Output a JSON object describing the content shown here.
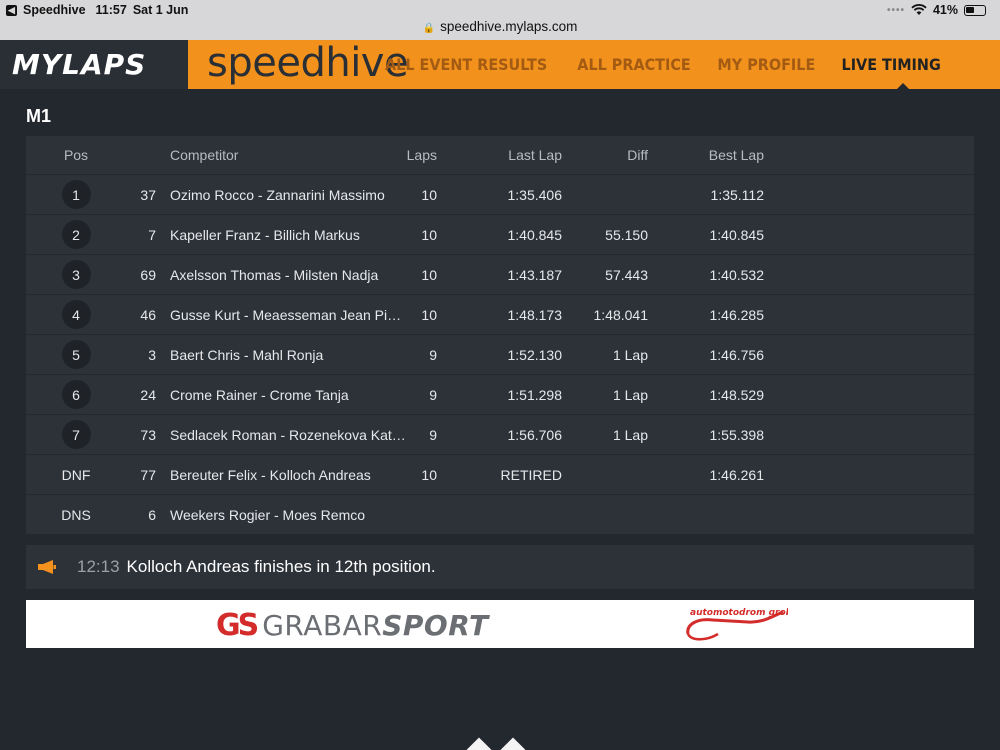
{
  "status_bar": {
    "app": "Speedhive",
    "time": "11:57",
    "date": "Sat 1 Jun",
    "battery": "41%",
    "url": "speedhive.mylaps.com"
  },
  "header": {
    "logo": "MYLAPS",
    "brand": "speedhive",
    "nav": [
      "ALL EVENT RESULTS",
      "ALL PRACTICE",
      "MY PROFILE",
      "LIVE TIMING"
    ],
    "active_nav": "LIVE TIMING",
    "accent_color": "#f2921c"
  },
  "session": {
    "class_name": "M1"
  },
  "table": {
    "headers": {
      "pos": "Pos",
      "competitor": "Competitor",
      "laps": "Laps",
      "last_lap": "Last Lap",
      "diff": "Diff",
      "best_lap": "Best Lap"
    },
    "rows": [
      {
        "pos": "1",
        "num": "37",
        "name": "Ozimo Rocco - Zannarini Massimo",
        "laps": "10",
        "last": "1:35.406",
        "diff": "",
        "best": "1:35.112"
      },
      {
        "pos": "2",
        "num": "7",
        "name": "Kapeller Franz - Billich Markus",
        "laps": "10",
        "last": "1:40.845",
        "diff": "55.150",
        "best": "1:40.845"
      },
      {
        "pos": "3",
        "num": "69",
        "name": "Axelsson Thomas - Milsten Nadja",
        "laps": "10",
        "last": "1:43.187",
        "diff": "57.443",
        "best": "1:40.532"
      },
      {
        "pos": "4",
        "num": "46",
        "name": "Gusse Kurt - Meaesseman Jean Pi…",
        "laps": "10",
        "last": "1:48.173",
        "diff": "1:48.041",
        "best": "1:46.285"
      },
      {
        "pos": "5",
        "num": "3",
        "name": "Baert Chris - Mahl Ronja",
        "laps": "9",
        "last": "1:52.130",
        "diff": "1 Lap",
        "best": "1:46.756"
      },
      {
        "pos": "6",
        "num": "24",
        "name": "Crome Rainer - Crome Tanja",
        "laps": "9",
        "last": "1:51.298",
        "diff": "1 Lap",
        "best": "1:48.529"
      },
      {
        "pos": "7",
        "num": "73",
        "name": "Sedlacek Roman - Rozenekova Kat…",
        "laps": "9",
        "last": "1:56.706",
        "diff": "1 Lap",
        "best": "1:55.398"
      },
      {
        "pos": "DNF",
        "num": "77",
        "name": "Bereuter Felix - Kolloch Andreas",
        "laps": "10",
        "last": "RETIRED",
        "diff": "",
        "best": "1:46.261"
      },
      {
        "pos": "DNS",
        "num": "6",
        "name": "Weekers Rogier - Moes Remco",
        "laps": "",
        "last": "",
        "diff": "",
        "best": ""
      }
    ]
  },
  "notice": {
    "icon": "megaphone-icon",
    "time": "12:13",
    "message": "Kolloch Andreas finishes in 12th position.",
    "icon_color": "#f2921c"
  },
  "sponsors": {
    "left_mark": "GS",
    "left_name_light": "GRABAR",
    "left_name_bold": "SPORT",
    "right_logo": "automotodrom grobnik"
  }
}
